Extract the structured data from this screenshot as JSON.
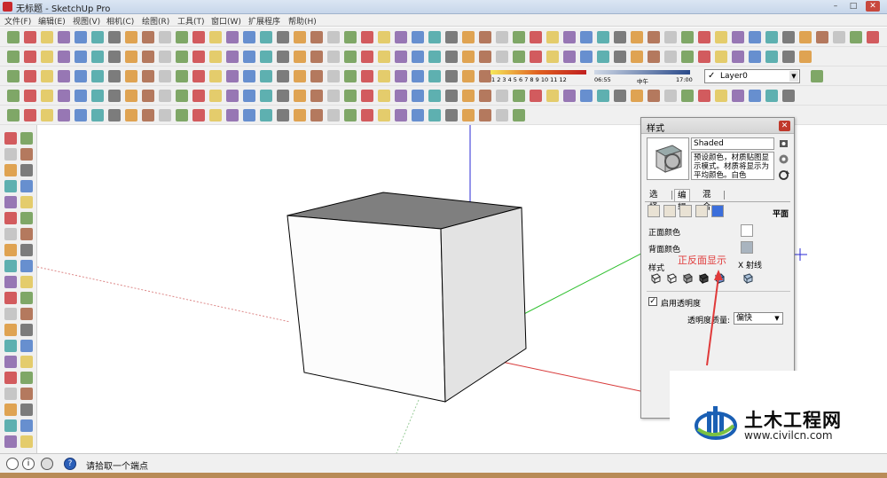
{
  "window": {
    "title": "无标题 - SketchUp Pro",
    "minimize": "–",
    "maximize": "□",
    "close": "✕"
  },
  "menu": [
    "文件(F)",
    "编辑(E)",
    "视图(V)",
    "相机(C)",
    "绘图(R)",
    "工具(T)",
    "窗口(W)",
    "扩展程序",
    "帮助(H)"
  ],
  "toolbar": {
    "date_ticks": "1 2 3 4 5 6 7 8 9 10 11 12",
    "time_start": "06:55",
    "time_mid": "中午",
    "time_end": "17:00",
    "layer_value": "Layer0"
  },
  "styles_panel": {
    "title": "样式",
    "close": "✕",
    "style_name": "Shaded",
    "description": "预设颜色，材质贴图显示模式。材质将显示为平均颜色。白色",
    "tabs": [
      "选择",
      "编辑",
      "混合"
    ],
    "active_tab": "编辑",
    "section_title": "平面",
    "front_color_label": "正面颜色",
    "back_color_label": "背面颜色",
    "front_color": "#ffffff",
    "back_color": "#a9b4bf",
    "style_label": "样式",
    "xray_label": "X 射线",
    "enable_transparency": "启用透明度",
    "enable_transparency_checked": "✓",
    "transparency_quality_label": "透明度质量:",
    "transparency_quality_value": "偏快"
  },
  "annotation": "正反面显示",
  "status": {
    "help_icon": "?",
    "info_icon": "i",
    "message": "请拾取一个端点"
  },
  "watermark": {
    "name": "土木工程网",
    "url": "www.civilcn.com"
  }
}
